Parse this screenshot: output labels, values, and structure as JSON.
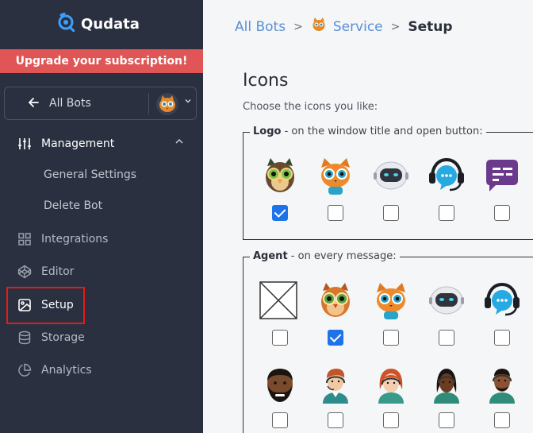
{
  "brand": {
    "name": "Qudata"
  },
  "upgrade_banner": "Upgrade your subscription!",
  "bot_selector": {
    "label": "All Bots"
  },
  "nav": {
    "management": "Management",
    "general_settings": "General Settings",
    "delete_bot": "Delete Bot",
    "integrations": "Integrations",
    "editor": "Editor",
    "setup": "Setup",
    "storage": "Storage",
    "analytics": "Analytics"
  },
  "breadcrumb": {
    "all_bots": "All Bots",
    "bot": "Service",
    "current": "Setup",
    "sep": ">"
  },
  "icons_section": {
    "title": "Icons",
    "description": "Choose the icons you like:",
    "logo_legend_bold": "Logo",
    "logo_legend_rest": " - on the window title and open button:",
    "agent_legend_bold": "Agent",
    "agent_legend_rest": " - on every message:"
  },
  "logo_icons": [
    {
      "icon": "owl-green-icon",
      "checked": true
    },
    {
      "icon": "cat-orange-icon",
      "checked": false
    },
    {
      "icon": "robot-head-icon",
      "checked": false
    },
    {
      "icon": "headset-chat-icon",
      "checked": false
    },
    {
      "icon": "purple-chat-bubble-icon",
      "checked": false
    }
  ],
  "agent_icons": [
    {
      "icon": "no-image-icon",
      "checked": false
    },
    {
      "icon": "owl-orange-icon",
      "checked": true
    },
    {
      "icon": "cat-orange-icon",
      "checked": false
    },
    {
      "icon": "robot-head-icon",
      "checked": false
    },
    {
      "icon": "headset-chat-icon",
      "checked": false
    },
    {
      "icon": "man-beard-avatar-icon",
      "checked": false
    },
    {
      "icon": "man-headset-avatar-icon",
      "checked": false
    },
    {
      "icon": "woman-redhead-headset-avatar-icon",
      "checked": false
    },
    {
      "icon": "woman-dark-headset-avatar-icon",
      "checked": false
    },
    {
      "icon": "man-dark-headset-avatar-icon",
      "checked": false
    }
  ],
  "colors": {
    "sidebar_bg": "#2b3040",
    "upgrade_bg": "#e05555",
    "link_blue": "#5b8fd6",
    "checkbox_blue": "#1f73e8",
    "highlight_red": "#e21b1b"
  }
}
